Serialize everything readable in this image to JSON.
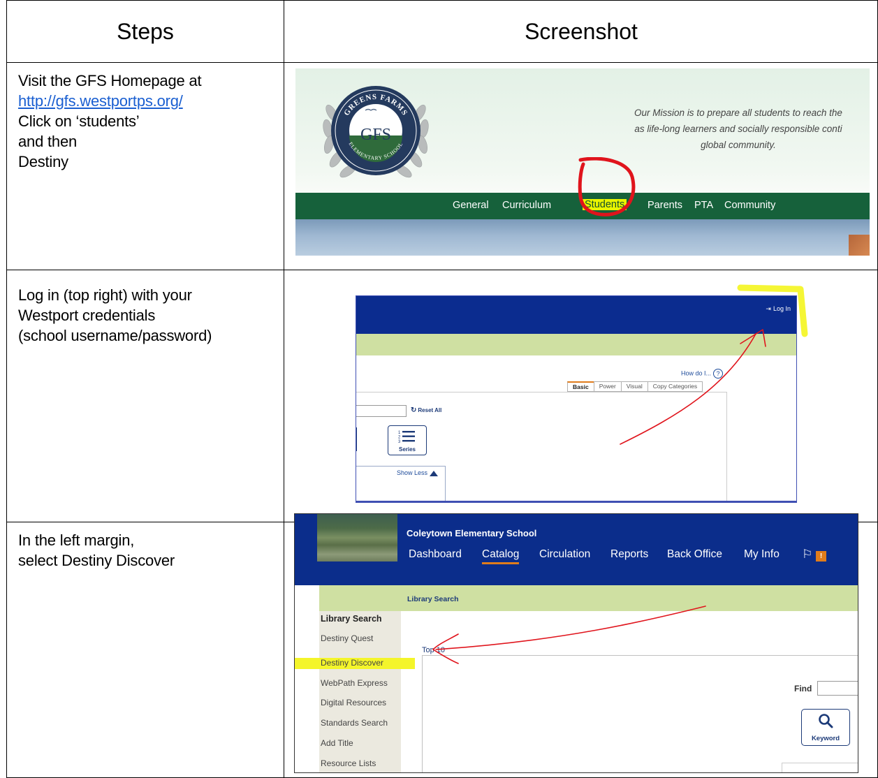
{
  "table": {
    "header_steps": "Steps",
    "header_screenshot": "Screenshot"
  },
  "rows": [
    {
      "lines": [
        "Visit the GFS Homepage at",
        "http://gfs.westportps.org/",
        "Click on ‘students’",
        "and then",
        "Destiny"
      ],
      "link": "http://gfs.westportps.org/"
    },
    {
      "lines": [
        "Log in (top right) with your",
        "Westport credentials",
        "(school username/password)"
      ]
    },
    {
      "lines": [
        "In the left margin,",
        "select Destiny Discover"
      ]
    }
  ],
  "shot1": {
    "logo": {
      "top_text": "GREENS FARMS",
      "center_text": "GFS",
      "bottom_text": "ELEMENTARY SCHOOL"
    },
    "mission_lines": [
      "Our Mission is to prepare all students to reach the",
      "as life-long learners and socially responsible conti",
      "global community."
    ],
    "nav": [
      "General",
      "Curriculum",
      "Students",
      "Parents",
      "PTA",
      "Community"
    ],
    "highlighted_nav": "Students",
    "colors": {
      "nav_bg": "#16613b",
      "highlight": "#eaf500",
      "annotation": "#e0141c"
    }
  },
  "shot2": {
    "login_label": "Log In",
    "help_label": "How do I...",
    "tabs": [
      "Basic",
      "Power",
      "Visual",
      "Copy Categories"
    ],
    "reset_label": "Reset All",
    "series_label": "Series",
    "show_less_label": "Show Less",
    "colors": {
      "top_bar": "#0b2c8f",
      "green_bar": "#cfe0a2",
      "highlight": "#f4f52a",
      "annotation": "#e0141c"
    }
  },
  "shot3": {
    "school_name": "Coleytown Elementary School",
    "nav": [
      "Dashboard",
      "Catalog",
      "Circulation",
      "Reports",
      "Back Office",
      "My Info"
    ],
    "active_nav": "Catalog",
    "flag_badge": "!",
    "breadcrumb": "Library Search",
    "sidebar": [
      "Library Search",
      "Destiny Quest",
      "Destiny Discover",
      "WebPath Express",
      "Digital Resources",
      "Standards Search",
      "Add Title",
      "Resource Lists"
    ],
    "highlighted_sidebar": "Destiny Discover",
    "top10_label": "Top 10",
    "find_label": "Find",
    "keyword_label": "Keyword",
    "colors": {
      "top_bar": "#0b2d8b",
      "green_bar": "#cfe0a2",
      "sidebar_bg": "#ebe9df",
      "highlight": "#f4f52a",
      "annotation": "#e0141c"
    }
  }
}
